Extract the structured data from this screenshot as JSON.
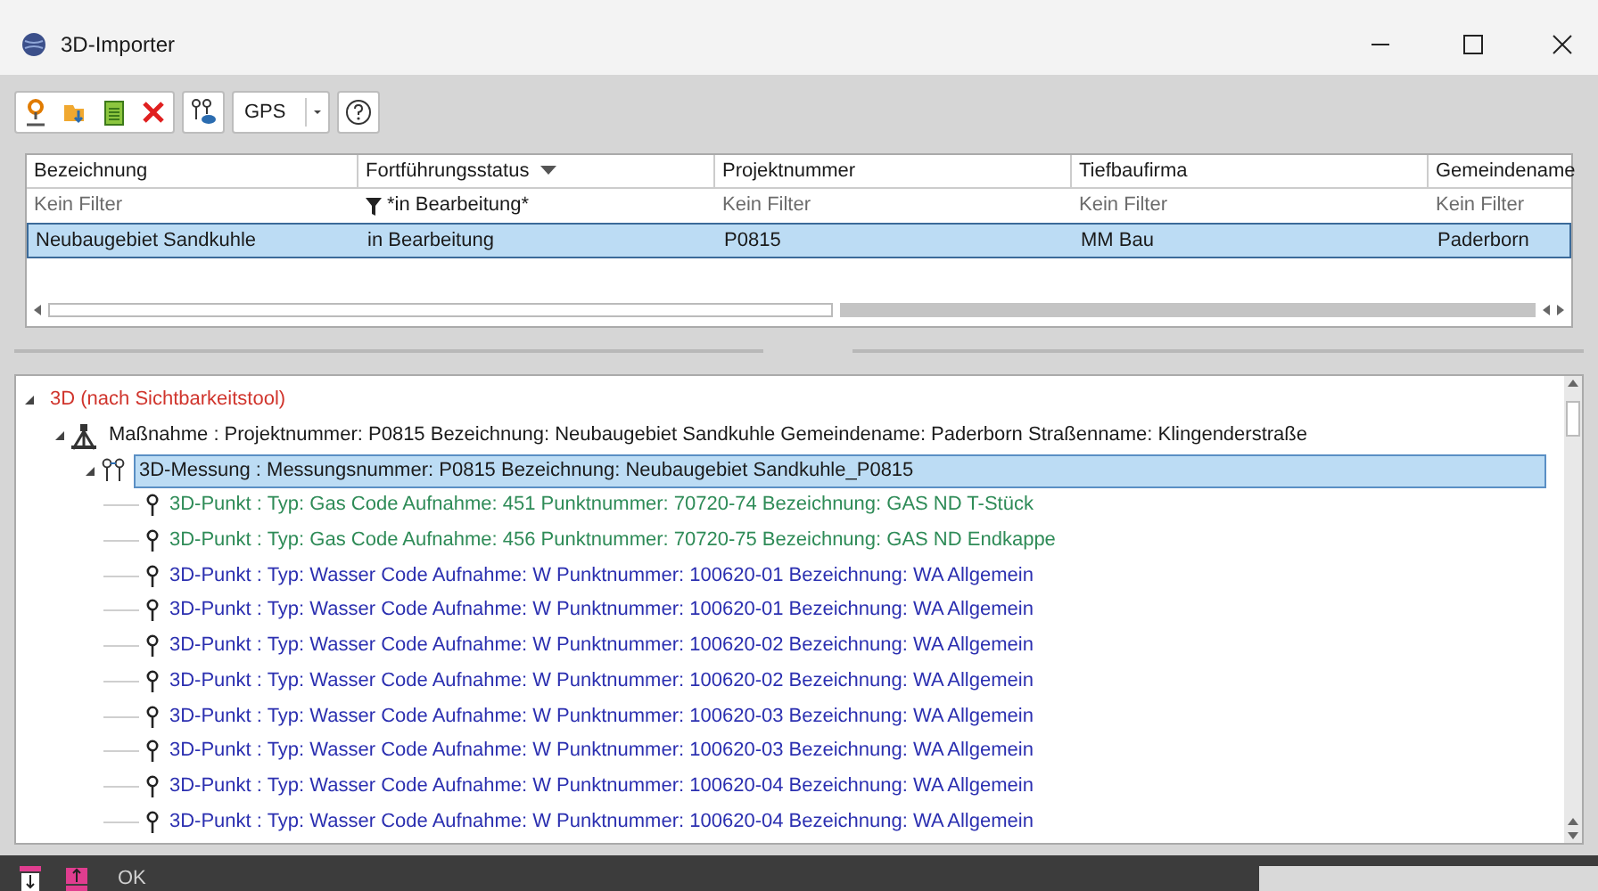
{
  "window": {
    "title": "3D-Importer"
  },
  "toolbar": {
    "gps": "GPS"
  },
  "table": {
    "columns": [
      {
        "label": "Bezeichnung",
        "sorted": false
      },
      {
        "label": "Fortführungsstatus",
        "sorted": true
      },
      {
        "label": "Projektnummer",
        "sorted": false
      },
      {
        "label": "Tiefbaufirma",
        "sorted": false
      },
      {
        "label": "Gemeindename",
        "sorted": false
      }
    ],
    "filters": [
      {
        "text": "Kein Filter",
        "active": false
      },
      {
        "text": "*in Bearbeitung*",
        "active": true
      },
      {
        "text": "Kein Filter",
        "active": false
      },
      {
        "text": "Kein Filter",
        "active": false
      },
      {
        "text": "Kein Filter",
        "active": false
      }
    ],
    "rows": [
      {
        "cells": [
          "Neubaugebiet Sandkuhle",
          "in Bearbeitung",
          "P0815",
          "MM Bau",
          "Paderborn"
        ],
        "selected": true
      }
    ]
  },
  "tree": [
    {
      "label": "3D (nach Sichtbarkeitstool)",
      "color": "#d0342c",
      "expanded": true,
      "selected": false,
      "children": [
        {
          "kind": "measure",
          "label": "Maßnahme :  Projektnummer: P0815 Bezeichnung: Neubaugebiet Sandkuhle Gemeindename: Paderborn Straßenname: Klingenderstraße",
          "color": "#1a1a1a",
          "expanded": true,
          "selected": false,
          "children": [
            {
              "kind": "measurement",
              "label": "3D-Messung :  Messungsnummer: P0815 Bezeichnung: Neubaugebiet Sandkuhle_P0815",
              "color": "#1a1a1a",
              "expanded": true,
              "selected": true,
              "children": [
                {
                  "kind": "point",
                  "label": "3D-Punkt :  Typ: Gas Code Aufnahme: 451 Punktnummer: 70720-74 Bezeichnung: GAS ND T-Stück",
                  "color": "#2e8b57",
                  "selected": false
                },
                {
                  "kind": "point",
                  "label": "3D-Punkt :  Typ: Gas Code Aufnahme: 456 Punktnummer: 70720-75 Bezeichnung: GAS ND Endkappe",
                  "color": "#2e8b57",
                  "selected": false
                },
                {
                  "kind": "point",
                  "label": "3D-Punkt :  Typ: Wasser Code Aufnahme: W Punktnummer: 100620-01 Bezeichnung: WA Allgemein",
                  "color": "#2b2fb0",
                  "selected": false
                },
                {
                  "kind": "point",
                  "label": "3D-Punkt :  Typ: Wasser Code Aufnahme: W Punktnummer: 100620-01 Bezeichnung: WA Allgemein",
                  "color": "#2b2fb0",
                  "selected": false
                },
                {
                  "kind": "point",
                  "label": "3D-Punkt :  Typ: Wasser Code Aufnahme: W Punktnummer: 100620-02 Bezeichnung: WA Allgemein",
                  "color": "#2b2fb0",
                  "selected": false
                },
                {
                  "kind": "point",
                  "label": "3D-Punkt :  Typ: Wasser Code Aufnahme: W Punktnummer: 100620-02 Bezeichnung: WA Allgemein",
                  "color": "#2b2fb0",
                  "selected": false
                },
                {
                  "kind": "point",
                  "label": "3D-Punkt :  Typ: Wasser Code Aufnahme: W Punktnummer: 100620-03 Bezeichnung: WA Allgemein",
                  "color": "#2b2fb0",
                  "selected": false
                },
                {
                  "kind": "point",
                  "label": "3D-Punkt :  Typ: Wasser Code Aufnahme: W Punktnummer: 100620-03 Bezeichnung: WA Allgemein",
                  "color": "#2b2fb0",
                  "selected": false
                },
                {
                  "kind": "point",
                  "label": "3D-Punkt :  Typ: Wasser Code Aufnahme: W Punktnummer: 100620-04 Bezeichnung: WA Allgemein",
                  "color": "#2b2fb0",
                  "selected": false
                },
                {
                  "kind": "point",
                  "label": "3D-Punkt :  Typ: Wasser Code Aufnahme: W Punktnummer: 100620-04 Bezeichnung: WA Allgemein",
                  "color": "#2b2fb0",
                  "selected": false
                }
              ]
            }
          ]
        }
      ]
    }
  ],
  "footer": {
    "ok": "OK"
  }
}
